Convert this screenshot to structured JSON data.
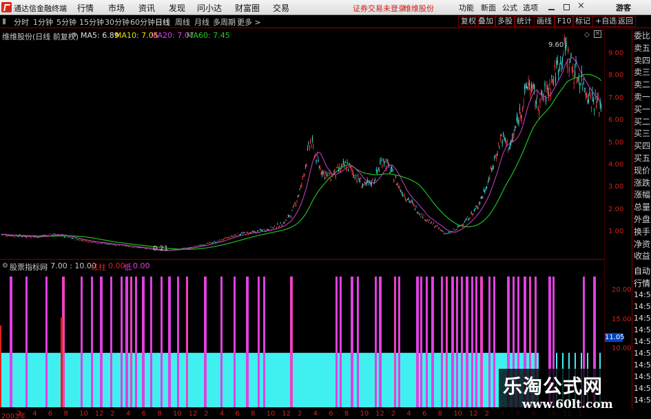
{
  "app_title": "通达信金融终端",
  "menu": [
    "行情",
    "市场",
    "资讯",
    "发现",
    "问小达",
    "财富圈",
    "交易"
  ],
  "notice": "证券交易未登录",
  "notice2": "维维股份",
  "menu_right": [
    "功能",
    "新面",
    "公式",
    "选项"
  ],
  "user": "游客",
  "periods": [
    "分时",
    "1分钟",
    "5分钟",
    "15分钟",
    "30分钟",
    "60分钟",
    "日线",
    "周线",
    "月线",
    "多周期",
    "更多 >"
  ],
  "active_period": "日线",
  "toolbar_right": [
    "复权",
    "叠加",
    "多股",
    "统计",
    "画线",
    "F10",
    "标记",
    "+自选",
    "返回"
  ],
  "main_chart": {
    "title": "维维股份(日线 前复权)",
    "ma": [
      {
        "name": "MA5",
        "value": "6.89",
        "color": "#e0e0e0"
      },
      {
        "name": "MA10",
        "value": "7.05",
        "color": "#e8e000"
      },
      {
        "name": "MA20",
        "value": "7.07",
        "color": "#e040e0"
      },
      {
        "name": "MA60",
        "value": "7.45",
        "color": "#20d020"
      }
    ],
    "high_label": "9.60",
    "low_label": "0.21",
    "y_ticks": [
      "9.00",
      "8.00",
      "7.00",
      "6.00",
      "5.00",
      "4.00",
      "3.00",
      "2.00",
      "1.00"
    ]
  },
  "sub_chart": {
    "title": "股票指标网",
    "params": ": 7.00 : 10.00",
    "red_label": "红柱",
    "red_val": "0.00",
    "low_label": "低",
    "low_val": "0.00",
    "y_ticks": [
      "20.00",
      "15.00",
      "10.00"
    ],
    "current_value": "11.05"
  },
  "right_panel": {
    "top_items": [
      "委比",
      "卖五",
      "卖四",
      "卖三",
      "卖二",
      "卖一",
      "买一",
      "买二",
      "买三",
      "买四",
      "买五",
      "现价",
      "涨跌",
      "涨幅",
      "总量",
      "外盘",
      "换手",
      "净资",
      "收益"
    ],
    "auto_label": "自动",
    "quote_label": "行情",
    "times": [
      "14:56",
      "14:56",
      "14:56",
      "14:56",
      "14:56",
      "14:56",
      "14:56",
      "14:56",
      "14:56",
      "14:56"
    ]
  },
  "x_axis": [
    "2003年",
    "2",
    "4",
    "6",
    "8",
    "10",
    "12",
    "2",
    "4",
    "6",
    "8",
    "10",
    "12",
    "2",
    "4",
    "6",
    "8",
    "10",
    "12",
    "2",
    "4",
    "6",
    "8",
    "10",
    "12",
    "2",
    "4",
    "6",
    "8",
    "10",
    "12",
    "2",
    "4",
    "6",
    "8",
    "10",
    "11",
    "1"
  ],
  "watermark": {
    "title": "乐淘公式网",
    "url": "www.60lt.com"
  },
  "chart_data": {
    "type": "candlestick",
    "series_price_trend": [
      1.0,
      0.95,
      0.92,
      0.9,
      0.88,
      0.95,
      1.0,
      0.9,
      0.8,
      0.72,
      0.65,
      0.6,
      0.55,
      0.5,
      0.45,
      0.4,
      0.35,
      0.3,
      0.25,
      0.28,
      0.35,
      0.4,
      0.5,
      0.6,
      0.7,
      0.85,
      1.0,
      1.05,
      1.1,
      1.2,
      1.3,
      1.5,
      2.0,
      3.2,
      5.3,
      4.1,
      3.6,
      3.9,
      4.2,
      3.7,
      3.2,
      3.5,
      4.5,
      3.8,
      3.0,
      2.5,
      2.0,
      1.6,
      1.3,
      1.0,
      1.2,
      1.6,
      2.0,
      2.8,
      4.0,
      5.5,
      5.0,
      6.5,
      8.0,
      7.0,
      7.5,
      8.5,
      9.6,
      8.5,
      8.0,
      7.2,
      6.9
    ],
    "ylim": [
      0,
      10
    ],
    "indicator": {
      "type": "bar",
      "cyan_level": 10,
      "magenta_peak": 25
    }
  }
}
